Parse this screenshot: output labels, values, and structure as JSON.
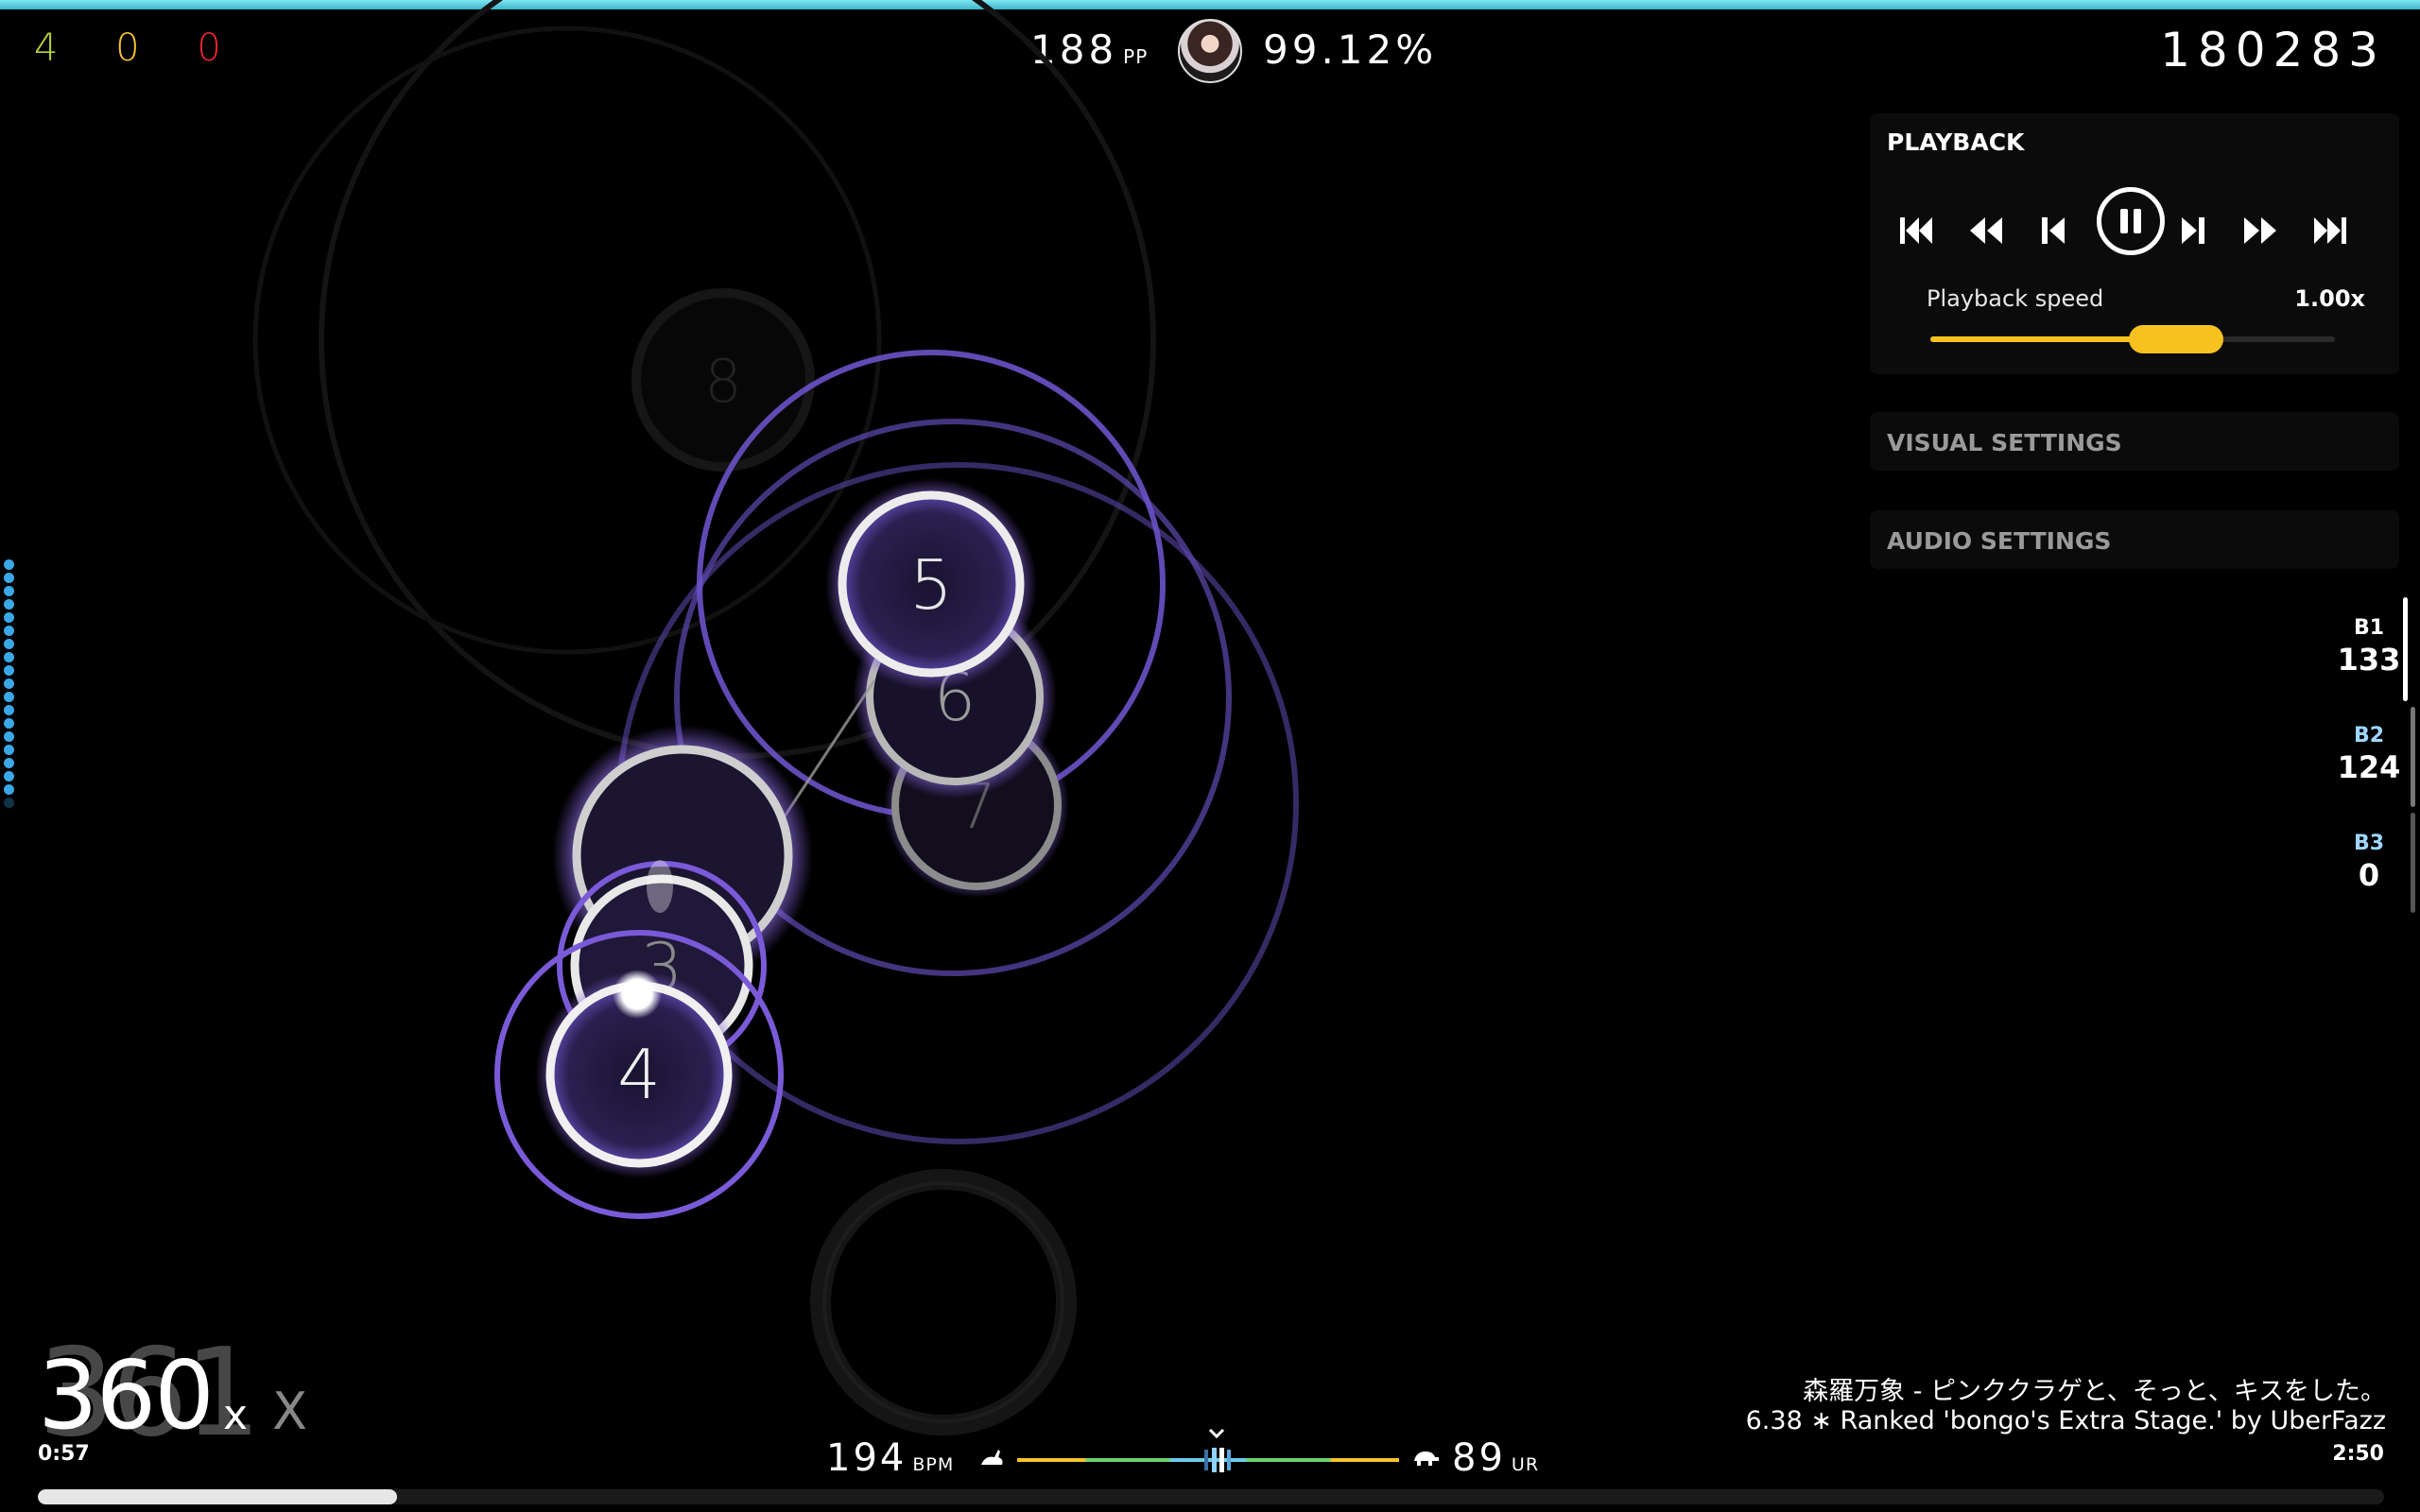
{
  "hud": {
    "hit_counts": [
      {
        "value": "4",
        "color": "#b5d334"
      },
      {
        "value": "0",
        "color": "#f4c430"
      },
      {
        "value": "0",
        "color": "#e8242f"
      }
    ],
    "pp_value": "188",
    "pp_unit": "PP",
    "accuracy": "99.12%",
    "score": "180283",
    "combo": "360",
    "combo_ghost": "361",
    "combo_suffix": "x",
    "combo_suffix_ghost": "X",
    "time_elapsed": "0:57",
    "time_total": "2:50",
    "bpm_value": "194",
    "bpm_unit": "BPM",
    "ur_value": "89",
    "ur_unit": "UR",
    "song_progress": 0.153
  },
  "playback": {
    "title": "PLAYBACK",
    "speed_label": "Playback speed",
    "speed_value": "1.00x",
    "speed_slider_fraction": 0.5,
    "buttons": [
      "skip-to-start-icon",
      "rewind-icon",
      "step-back-icon",
      "pause-icon",
      "step-forward-icon",
      "fast-forward-icon",
      "skip-to-end-icon"
    ]
  },
  "settings": {
    "visual": "VISUAL SETTINGS",
    "audio": "AUDIO SETTINGS"
  },
  "keys": [
    {
      "label": "B1",
      "value": "133"
    },
    {
      "label": "B2",
      "value": "124"
    },
    {
      "label": "B3",
      "value": "0"
    }
  ],
  "song": {
    "title_line": "森羅万象 - ピンククラゲと、そっと、キスをした。",
    "difficulty_line": "6.38 ∗ Ranked 'bongo's Extra Stage.' by UberFazz"
  },
  "hit_circles": [
    {
      "number": "8"
    },
    {
      "number": "7"
    },
    {
      "number": "6"
    },
    {
      "number": "5"
    },
    {
      "number": "3"
    },
    {
      "number": "4"
    }
  ],
  "colors": {
    "accent_cyan": "#5fd0df",
    "approach_purple": "#7a5ad8",
    "speed_yellow": "#f7c21f",
    "health_blue": "#3aa8e6"
  }
}
